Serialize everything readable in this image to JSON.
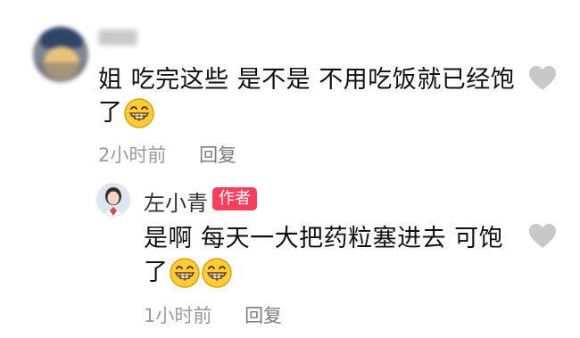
{
  "comment": {
    "line1": "姐 吃完这些 是不是 不用吃饭就已经饱",
    "line2": "了",
    "emoji": "grin-emoji",
    "time": "2小时前",
    "reply_label": "回复"
  },
  "reply": {
    "author": "左小青",
    "badge": "作者",
    "line1": "是啊 每天一大把药粒塞进去 可饱",
    "line2": "了",
    "emoji_count": 2,
    "time": "1小时前",
    "reply_label": "回复"
  },
  "colors": {
    "badge_bg": "#fa3e5c",
    "meta_text": "#9b9b9b",
    "heart": "#c8c8c8"
  },
  "icons": [
    "heart-icon",
    "grin-emoji"
  ]
}
